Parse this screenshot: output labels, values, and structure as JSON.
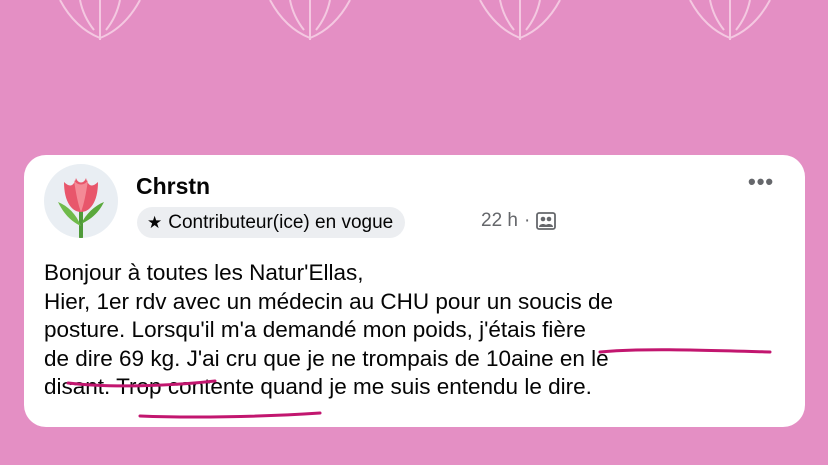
{
  "post": {
    "author": "Chrstn",
    "badge_label": "Contributeur(ice) en vogue",
    "timestamp": "22 h",
    "separator": "·",
    "audience_icon": "group-icon",
    "more_icon": "more-icon",
    "more_glyph": "•••",
    "avatar_icon": "tulip-icon",
    "badge_icon": "star-icon",
    "lines": [
      "Bonjour à toutes les Natur'Ellas,",
      "Hier, 1er rdv avec un médecin au CHU pour un soucis de",
      "posture. Lorsqu'il m'a demandé mon poids, j'étais fière",
      "de dire 69 kg. J'ai cru que je ne trompais de 10aine en le",
      "disant. Trop contente quand je me suis entendu le dire."
    ]
  },
  "colors": {
    "background": "#e48fc4",
    "card": "#ffffff",
    "annotation": "#c2166f"
  }
}
